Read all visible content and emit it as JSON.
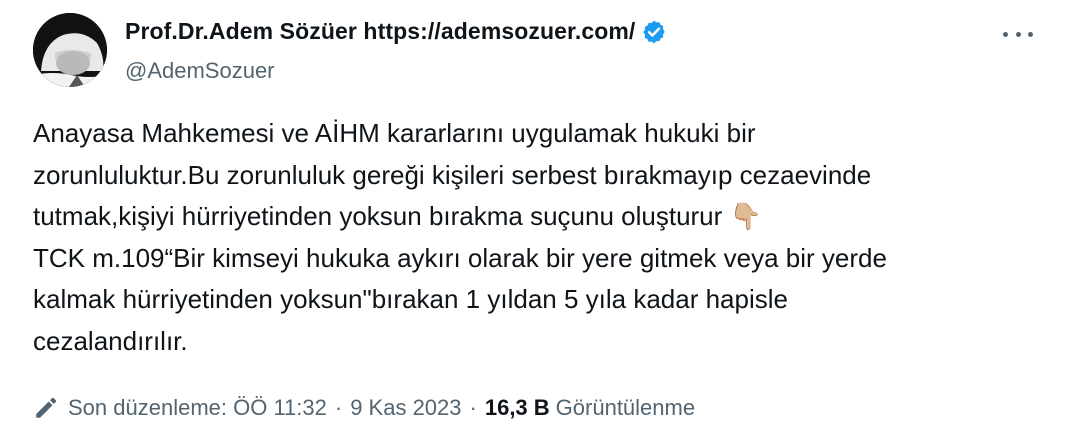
{
  "author": {
    "display_name": "Prof.Dr.Adem Sözüer https://ademsozuer.com/",
    "handle": "@AdemSozuer",
    "verified": true
  },
  "tweet": {
    "text": "Anayasa Mahkemesi ve AİHM kararlarını uygulamak hukuki bir\nzorunluluktur.Bu zorunluluk gereği kişileri serbest bırakmayıp cezaevinde\ntutmak,kişiyi hürriyetinden yoksun bırakma suçunu oluşturur 👇🏼\nTCK m.109“Bir kimseyi hukuka aykırı olarak bir yere gitmek veya bir yerde\nkalmak hürriyetinden yoksun\"bırakan 1 yıldan 5 yıla kadar hapisle\ncezalandırılır."
  },
  "footer": {
    "edited_label": "Son düzenleme: ÖÖ 11:32",
    "separator": "·",
    "date": "9 Kas 2023",
    "views_count": "16,3 B",
    "views_label": "Görüntülenme"
  },
  "icons": {
    "more": "more-horizontal-icon",
    "verified": "verified-badge-icon",
    "edit": "pencil-icon"
  },
  "colors": {
    "primary_text": "#0f1419",
    "secondary_text": "#536471",
    "verified_blue": "#1d9bf0"
  }
}
